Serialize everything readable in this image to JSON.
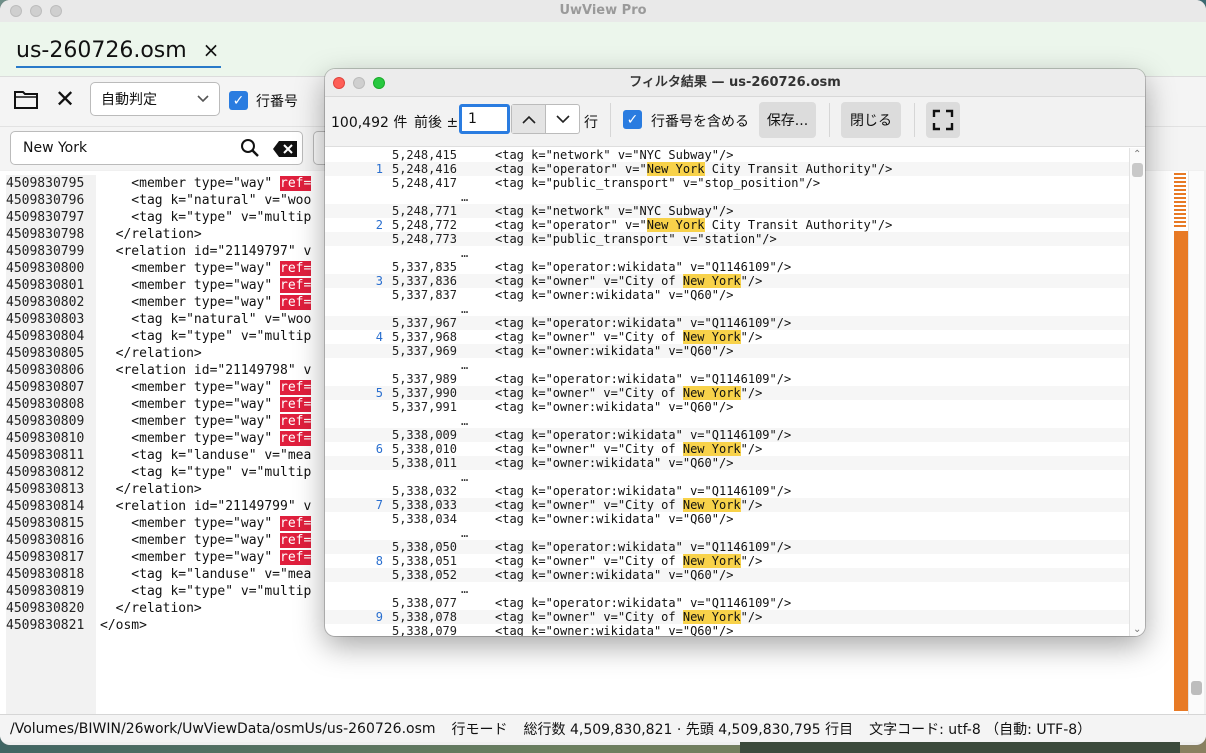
{
  "app": {
    "title": "UwView Pro"
  },
  "tab": {
    "label": "us-260726.osm",
    "close": "×"
  },
  "toolbar": {
    "encoding_select": "自動判定",
    "line_numbers_label": "行番号"
  },
  "search": {
    "value": "New York"
  },
  "editor": {
    "lines": [
      {
        "n": "4509830795",
        "pre": "    <member type=\"way\" ",
        "hl": "ref=",
        "post": ""
      },
      {
        "n": "4509830796",
        "pre": "    <tag k=\"natural\" v=\"woo",
        "hl": "",
        "post": ""
      },
      {
        "n": "4509830797",
        "pre": "    <tag k=\"type\" v=\"multip",
        "hl": "",
        "post": ""
      },
      {
        "n": "4509830798",
        "pre": "  </relation>",
        "hl": "",
        "post": ""
      },
      {
        "n": "4509830799",
        "pre": "  <relation id=\"21149797\" v",
        "hl": "",
        "post": ""
      },
      {
        "n": "4509830800",
        "pre": "    <member type=\"way\" ",
        "hl": "ref=",
        "post": ""
      },
      {
        "n": "4509830801",
        "pre": "    <member type=\"way\" ",
        "hl": "ref=",
        "post": ""
      },
      {
        "n": "4509830802",
        "pre": "    <member type=\"way\" ",
        "hl": "ref=",
        "post": ""
      },
      {
        "n": "4509830803",
        "pre": "    <tag k=\"natural\" v=\"woo",
        "hl": "",
        "post": ""
      },
      {
        "n": "4509830804",
        "pre": "    <tag k=\"type\" v=\"multip",
        "hl": "",
        "post": ""
      },
      {
        "n": "4509830805",
        "pre": "  </relation>",
        "hl": "",
        "post": ""
      },
      {
        "n": "4509830806",
        "pre": "  <relation id=\"21149798\" v",
        "hl": "",
        "post": ""
      },
      {
        "n": "4509830807",
        "pre": "    <member type=\"way\" ",
        "hl": "ref=",
        "post": ""
      },
      {
        "n": "4509830808",
        "pre": "    <member type=\"way\" ",
        "hl": "ref=",
        "post": ""
      },
      {
        "n": "4509830809",
        "pre": "    <member type=\"way\" ",
        "hl": "ref=",
        "post": ""
      },
      {
        "n": "4509830810",
        "pre": "    <member type=\"way\" ",
        "hl": "ref=",
        "post": ""
      },
      {
        "n": "4509830811",
        "pre": "    <tag k=\"landuse\" v=\"mea",
        "hl": "",
        "post": ""
      },
      {
        "n": "4509830812",
        "pre": "    <tag k=\"type\" v=\"multip",
        "hl": "",
        "post": ""
      },
      {
        "n": "4509830813",
        "pre": "  </relation>",
        "hl": "",
        "post": ""
      },
      {
        "n": "4509830814",
        "pre": "  <relation id=\"21149799\" v",
        "hl": "",
        "post": ""
      },
      {
        "n": "4509830815",
        "pre": "    <member type=\"way\" ",
        "hl": "ref=",
        "post": ""
      },
      {
        "n": "4509830816",
        "pre": "    <member type=\"way\" ",
        "hl": "ref=",
        "post": ""
      },
      {
        "n": "4509830817",
        "pre": "    <member type=\"way\" ",
        "hl": "ref=",
        "post": ""
      },
      {
        "n": "4509830818",
        "pre": "    <tag k=\"landuse\" v=\"mea",
        "hl": "",
        "post": ""
      },
      {
        "n": "4509830819",
        "pre": "    <tag k=\"type\" v=\"multip",
        "hl": "",
        "post": ""
      },
      {
        "n": "4509830820",
        "pre": "  </relation>",
        "hl": "",
        "post": ""
      },
      {
        "n": "4509830821",
        "pre": "</osm>",
        "hl": "",
        "post": ""
      }
    ]
  },
  "status": {
    "path": "/Volumes/BIWIN/26work/UwViewData/osmUs/us-260726.osm",
    "mode": "行モード",
    "totals": "総行数 4,509,830,821 · 先頭 4,509,830,795 行目",
    "encoding": "文字コード: utf-8 （自動: UTF-8）"
  },
  "filter": {
    "title": "フィルタ結果 — us-260726.osm",
    "count": "100,492 件",
    "context_label": "前後 ±",
    "context_value": "1",
    "row_label": "行",
    "include_lines_label": "行番号を含める",
    "save_label": "保存...",
    "close_label": "閉じる",
    "ellipsis": "…",
    "rows": [
      {
        "m": "",
        "n": "5,248,415",
        "a": "<tag k=\"network\" v=\"NYC Subway\"/>",
        "h": "",
        "b": ""
      },
      {
        "m": "1",
        "n": "5,248,416",
        "a": "<tag k=\"operator\" v=\"",
        "h": "New York",
        "b": " City Transit Authority\"/>"
      },
      {
        "m": "",
        "n": "5,248,417",
        "a": "<tag k=\"public_transport\" v=\"stop_position\"/>",
        "h": "",
        "b": ""
      },
      {
        "sep": true
      },
      {
        "m": "",
        "n": "5,248,771",
        "a": "<tag k=\"network\" v=\"NYC Subway\"/>",
        "h": "",
        "b": ""
      },
      {
        "m": "2",
        "n": "5,248,772",
        "a": "<tag k=\"operator\" v=\"",
        "h": "New York",
        "b": " City Transit Authority\"/>"
      },
      {
        "m": "",
        "n": "5,248,773",
        "a": "<tag k=\"public_transport\" v=\"station\"/>",
        "h": "",
        "b": ""
      },
      {
        "sep": true
      },
      {
        "m": "",
        "n": "5,337,835",
        "a": "<tag k=\"operator:wikidata\" v=\"Q1146109\"/>",
        "h": "",
        "b": ""
      },
      {
        "m": "3",
        "n": "5,337,836",
        "a": "<tag k=\"owner\" v=\"City of ",
        "h": "New York",
        "b": "\"/>"
      },
      {
        "m": "",
        "n": "5,337,837",
        "a": "<tag k=\"owner:wikidata\" v=\"Q60\"/>",
        "h": "",
        "b": ""
      },
      {
        "sep": true
      },
      {
        "m": "",
        "n": "5,337,967",
        "a": "<tag k=\"operator:wikidata\" v=\"Q1146109\"/>",
        "h": "",
        "b": ""
      },
      {
        "m": "4",
        "n": "5,337,968",
        "a": "<tag k=\"owner\" v=\"City of ",
        "h": "New York",
        "b": "\"/>"
      },
      {
        "m": "",
        "n": "5,337,969",
        "a": "<tag k=\"owner:wikidata\" v=\"Q60\"/>",
        "h": "",
        "b": ""
      },
      {
        "sep": true
      },
      {
        "m": "",
        "n": "5,337,989",
        "a": "<tag k=\"operator:wikidata\" v=\"Q1146109\"/>",
        "h": "",
        "b": ""
      },
      {
        "m": "5",
        "n": "5,337,990",
        "a": "<tag k=\"owner\" v=\"City of ",
        "h": "New York",
        "b": "\"/>"
      },
      {
        "m": "",
        "n": "5,337,991",
        "a": "<tag k=\"owner:wikidata\" v=\"Q60\"/>",
        "h": "",
        "b": ""
      },
      {
        "sep": true
      },
      {
        "m": "",
        "n": "5,338,009",
        "a": "<tag k=\"operator:wikidata\" v=\"Q1146109\"/>",
        "h": "",
        "b": ""
      },
      {
        "m": "6",
        "n": "5,338,010",
        "a": "<tag k=\"owner\" v=\"City of ",
        "h": "New York",
        "b": "\"/>"
      },
      {
        "m": "",
        "n": "5,338,011",
        "a": "<tag k=\"owner:wikidata\" v=\"Q60\"/>",
        "h": "",
        "b": ""
      },
      {
        "sep": true
      },
      {
        "m": "",
        "n": "5,338,032",
        "a": "<tag k=\"operator:wikidata\" v=\"Q1146109\"/>",
        "h": "",
        "b": ""
      },
      {
        "m": "7",
        "n": "5,338,033",
        "a": "<tag k=\"owner\" v=\"City of ",
        "h": "New York",
        "b": "\"/>"
      },
      {
        "m": "",
        "n": "5,338,034",
        "a": "<tag k=\"owner:wikidata\" v=\"Q60\"/>",
        "h": "",
        "b": ""
      },
      {
        "sep": true
      },
      {
        "m": "",
        "n": "5,338,050",
        "a": "<tag k=\"operator:wikidata\" v=\"Q1146109\"/>",
        "h": "",
        "b": ""
      },
      {
        "m": "8",
        "n": "5,338,051",
        "a": "<tag k=\"owner\" v=\"City of ",
        "h": "New York",
        "b": "\"/>"
      },
      {
        "m": "",
        "n": "5,338,052",
        "a": "<tag k=\"owner:wikidata\" v=\"Q60\"/>",
        "h": "",
        "b": ""
      },
      {
        "sep": true
      },
      {
        "m": "",
        "n": "5,338,077",
        "a": "<tag k=\"operator:wikidata\" v=\"Q1146109\"/>",
        "h": "",
        "b": ""
      },
      {
        "m": "9",
        "n": "5,338,078",
        "a": "<tag k=\"owner\" v=\"City of ",
        "h": "New York",
        "b": "\"/>"
      },
      {
        "m": "",
        "n": "5,338,079",
        "a": "<tag k=\"owner:wikidata\" v=\"Q60\"/>",
        "h": "",
        "b": ""
      }
    ]
  },
  "colors": {
    "accent": "#2a7ce0",
    "search_hit": "#e01f3d",
    "filter_hit": "#f8d24a",
    "minimap": "#e87a25"
  },
  "icons": {
    "folder": "folder-icon",
    "close": "close-icon",
    "search": "search-icon",
    "clear": "clear-search-icon",
    "fullscreen": "fullscreen-icon"
  }
}
